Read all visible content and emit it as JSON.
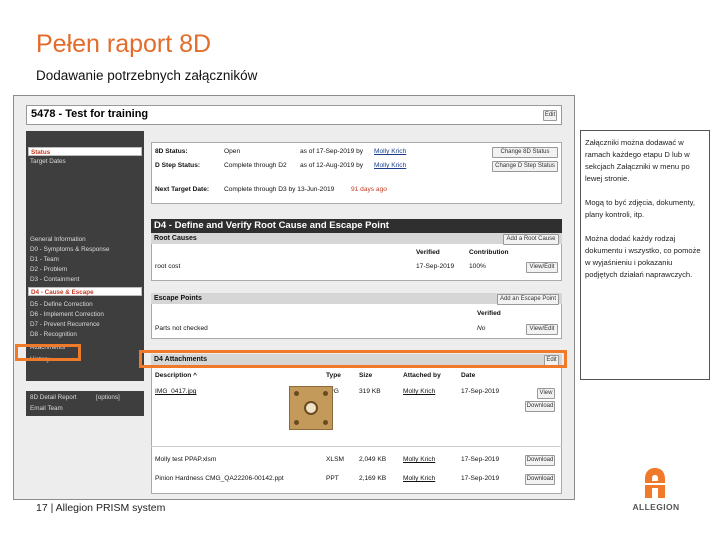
{
  "slide": {
    "title": "Pełen raport 8D",
    "subtitle": "Dodawanie potrzebnych załączników",
    "footer": "17 | Allegion PRISM system",
    "logo_text": "ALLEGION",
    "accent_color": "#e36c2b",
    "highlight_color": "#f07a2a"
  },
  "app": {
    "title": "5478 - Test for training",
    "edit_label": "Edit"
  },
  "sidebar": {
    "top": [
      {
        "label": "Status",
        "active": true
      },
      {
        "label": "Target Dates",
        "active": false
      }
    ],
    "items": [
      {
        "label": "General Information",
        "active": false
      },
      {
        "label": "D0 - Symptoms & Response",
        "active": false
      },
      {
        "label": "D1 - Team",
        "active": false
      },
      {
        "label": "D2 - Problem",
        "active": false
      },
      {
        "label": "D3 - Containment",
        "active": false
      },
      {
        "label": "D4 - Cause & Escape",
        "active": true
      },
      {
        "label": "D5 - Define Correction",
        "active": false
      },
      {
        "label": "D6 - Implement Correction",
        "active": false
      },
      {
        "label": "D7 - Prevent Recurrence",
        "active": false
      },
      {
        "label": "D8 - Recognition",
        "active": false
      },
      {
        "label": "Attachments",
        "active": false
      },
      {
        "label": "History",
        "active": false
      }
    ],
    "bottom": [
      {
        "label": "8D Detail Report"
      },
      {
        "label": "Email Team"
      }
    ],
    "options_label": "[options]"
  },
  "status": {
    "rows": [
      {
        "label": "8D Status:",
        "value": "Open",
        "info": "as of 17-Sep-2019 by",
        "who": "Molly Krich",
        "button": "Change 8D Status"
      },
      {
        "label": "D Step Status:",
        "value": "Complete through D2",
        "info": "as of 12-Aug-2019 by",
        "who": "Molly Krich",
        "button": "Change D Step Status"
      }
    ],
    "next_target_label": "Next Target Date:",
    "next_target_value": "Complete through D3 by 13-Jun-2019",
    "days_ago": "91 days ago"
  },
  "d4": {
    "title": "D4 - Define and Verify Root Cause and Escape Point",
    "root_causes": {
      "header": "Root Causes",
      "add_button": "Add a Root Cause",
      "columns": [
        "Verified",
        "Contribution"
      ],
      "row": {
        "name": "root cost",
        "verified": "17-Sep-2019",
        "contribution": "100%",
        "button": "View/Edit"
      }
    },
    "escape_points": {
      "header": "Escape Points",
      "add_button": "Add an Escape Point",
      "columns": [
        "Verified"
      ],
      "row": {
        "name": "Parts not checked",
        "verified": "No",
        "button": "View/Edit"
      }
    },
    "attachments": {
      "header": "D4 Attachments",
      "edit_button": "Edit",
      "columns": [
        "Description ^",
        "Type",
        "Size",
        "Attached by",
        "Date"
      ],
      "rows": [
        {
          "description": "IMG_0417.jpg",
          "type": "JPG",
          "size": "319 KB",
          "attached_by": "Molly Krich",
          "date": "17-Sep-2019",
          "buttons": [
            "View",
            "Download"
          ]
        },
        {
          "description": "Molly test PPAP.xlsm",
          "type": "XLSM",
          "size": "2,049 KB",
          "attached_by": "Molly Krich",
          "date": "17-Sep-2019",
          "buttons": [
            "Download"
          ]
        },
        {
          "description": "Pinion Hardness CMG_QA22206-00142.ppt",
          "type": "PPT",
          "size": "2,169 KB",
          "attached_by": "Molly Krich",
          "date": "17-Sep-2019",
          "buttons": [
            "Download"
          ]
        }
      ]
    }
  },
  "notes": [
    "Załączniki można dodawać w ramach każdego etapu D lub w sekcjach Załączniki w menu po lewej stronie.",
    "Mogą to być zdjęcia, dokumenty, plany kontroli, itp.",
    "Można dodać każdy rodzaj dokumentu i wszystko, co pomoże w wyjaśnieniu i pokazaniu podjętych działań naprawczych."
  ]
}
